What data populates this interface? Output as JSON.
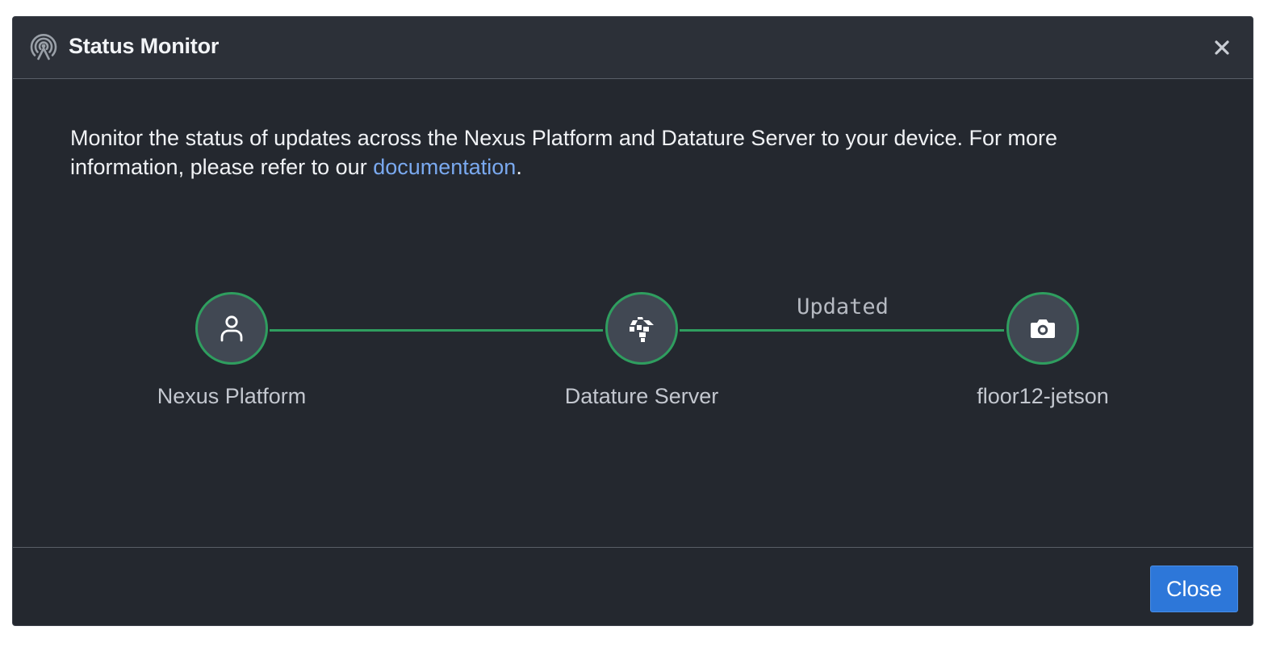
{
  "dialog": {
    "title": "Status Monitor",
    "header_icon": "broadcast-tower-icon",
    "close_icon": "close-icon"
  },
  "intro": {
    "text_before_link": "Monitor the status of updates across the Nexus Platform and Datature Server to your device. For more information, please refer to our ",
    "link_text": "documentation",
    "text_after_link": "."
  },
  "flow": {
    "nodes": [
      {
        "label": "Nexus Platform",
        "icon": "user-icon"
      },
      {
        "label": "Datature Server",
        "icon": "datature-logo-icon"
      },
      {
        "label": "floor12-jetson",
        "icon": "camera-icon"
      }
    ],
    "connections": [
      {
        "from": "Nexus Platform",
        "to": "Datature Server",
        "status": ""
      },
      {
        "from": "Datature Server",
        "to": "floor12-jetson",
        "status": "Updated"
      }
    ]
  },
  "footer": {
    "close_label": "Close"
  },
  "colors": {
    "background": "#24282f",
    "header": "#2c3038",
    "success_green": "#2f9e5f",
    "link": "#7aa9ef",
    "primary_button": "#2d77d9"
  }
}
